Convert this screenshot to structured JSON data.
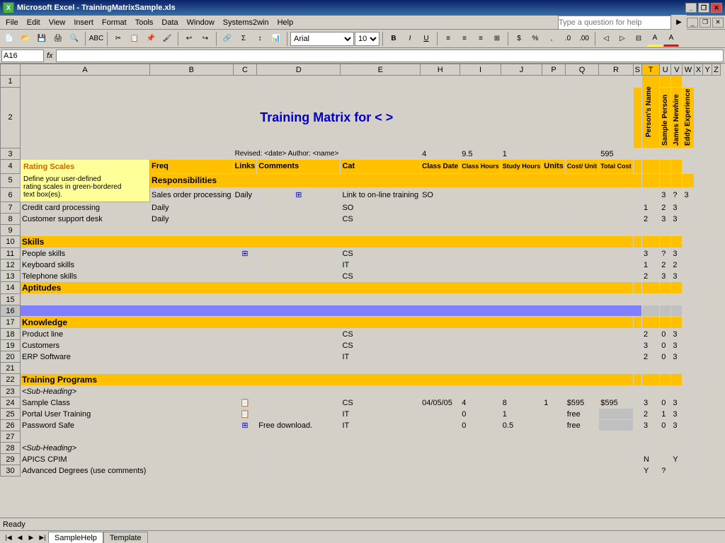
{
  "window": {
    "title": "Microsoft Excel - TrainingMatrixSample.xls",
    "icon": "excel-icon"
  },
  "menu": {
    "items": [
      "File",
      "Edit",
      "View",
      "Insert",
      "Format",
      "Tools",
      "Data",
      "Window",
      "Systems2win",
      "Help"
    ]
  },
  "toolbar": {
    "font": "Arial",
    "font_size": "10",
    "help_placeholder": "Type a question for help"
  },
  "formula_bar": {
    "cell_ref": "A16",
    "fx_label": "fx",
    "formula": ""
  },
  "sheet": {
    "title": "Training Matrix for < >",
    "revised_line": "Revised: <date>  Author: <name>",
    "stats": {
      "c4": "4",
      "h3": "9.5",
      "j3": "1",
      "r3": "595"
    },
    "headers": {
      "freq": "Freq",
      "links": "Links",
      "comments": "Comments",
      "cat": "Cat",
      "class_date": "Class Date",
      "class_hours": "Class Hours",
      "study_hours": "Study Hours",
      "units": "Units",
      "cost_unit": "Cost/ Unit",
      "total_cost": "Total Cost",
      "persons_name": "Person's Name",
      "sample_person": "Sample Person",
      "james_newhire": "James Newhire",
      "eddy_experience": "Eddy Experience"
    },
    "rating_text": "Rating Scales\n\nDefine your user-defined rating scales in green-bordered text box(es).",
    "sections": [
      {
        "name": "Responsibilities",
        "row": 5
      },
      {
        "name": "Skills",
        "row": 10
      },
      {
        "name": "Aptitudes",
        "row": 14
      },
      {
        "name": "Knowledge",
        "row": 17
      },
      {
        "name": "Training Programs",
        "row": 22
      }
    ],
    "rows": {
      "responsibilities": [
        {
          "row": 6,
          "name": "Sales order processing",
          "freq": "Daily",
          "links": "⊞",
          "comments": "Link to on-line training",
          "cat": "SO",
          "r": "3",
          "s": "?",
          "t": "3"
        },
        {
          "row": 7,
          "name": "Credit card processing",
          "freq": "Daily",
          "cat": "SO",
          "r": "1",
          "s": "2",
          "t": "3"
        },
        {
          "row": 8,
          "name": "Customer support desk",
          "freq": "Daily",
          "cat": "CS",
          "r": "2",
          "s": "3",
          "t": "3"
        }
      ],
      "skills": [
        {
          "row": 11,
          "name": "People skills",
          "links": "⊞",
          "cat": "CS",
          "r": "3",
          "s": "?",
          "t": "3"
        },
        {
          "row": 12,
          "name": "Keyboard skills",
          "cat": "IT",
          "r": "1",
          "s": "2",
          "t": "2"
        },
        {
          "row": 13,
          "name": "Telephone skills",
          "cat": "CS",
          "r": "2",
          "s": "3",
          "t": "3"
        }
      ],
      "aptitudes": [],
      "knowledge": [
        {
          "row": 18,
          "name": "Product line",
          "cat": "CS",
          "r": "2",
          "s": "0",
          "t": "3"
        },
        {
          "row": 19,
          "name": "Customers",
          "cat": "CS",
          "r": "3",
          "s": "0",
          "t": "3"
        },
        {
          "row": 20,
          "name": "ERP Software",
          "cat": "IT",
          "r": "2",
          "s": "0",
          "t": "3"
        }
      ],
      "training": [
        {
          "row": 23,
          "name": "<Sub-Heading>",
          "subheading": true
        },
        {
          "row": 24,
          "name": "Sample Class",
          "links": "📋",
          "cat": "CS",
          "class_date": "04/05/05",
          "class_hrs": "4",
          "study_hrs": "8",
          "units": "1",
          "cost_unit": "$595",
          "total_cost": "$595",
          "r": "3",
          "s": "0",
          "t": "3"
        },
        {
          "row": 25,
          "name": "Portal User Training",
          "links": "📋",
          "cat": "IT",
          "class_hrs": "0",
          "study_hrs": "1",
          "cost_unit": "free",
          "r": "2",
          "s": "1",
          "t": "3"
        },
        {
          "row": 26,
          "name": "Password Safe",
          "links": "⊞",
          "comments": "Free download.",
          "cat": "IT",
          "class_hrs": "0",
          "study_hrs": "0.5",
          "cost_unit": "free",
          "r": "3",
          "s": "0",
          "t": "3"
        },
        {
          "row": 28,
          "name": "<Sub-Heading>",
          "subheading": true
        },
        {
          "row": 29,
          "name": "APICS CPIM",
          "r": "N",
          "t": "Y"
        },
        {
          "row": 30,
          "name": "Advanced Degrees (use comments)",
          "s": "Y",
          "t": "?"
        }
      ]
    }
  },
  "tabs": [
    "SampleHelp",
    "Template"
  ],
  "active_tab": "SampleHelp",
  "status": "Ready"
}
